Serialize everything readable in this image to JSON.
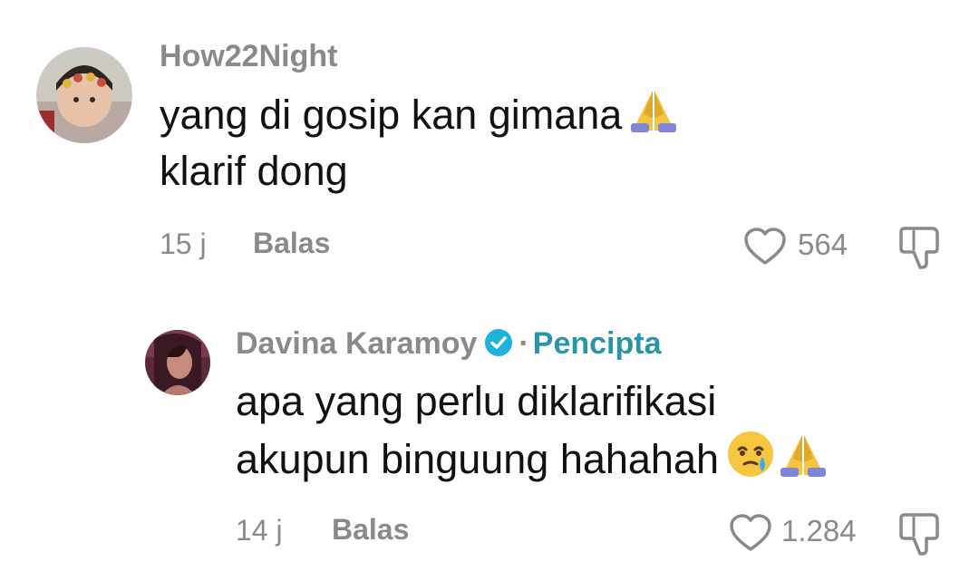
{
  "comments": [
    {
      "username": "How22Night",
      "text_line1": "yang di gosip kan gimana",
      "text_line2": "klarif dong",
      "emojis_line1": [
        "folded-hands"
      ],
      "time": "15 j",
      "reply_label": "Balas",
      "likes": "564"
    },
    {
      "username": "Davina Karamoy",
      "verified": true,
      "separator": "·",
      "creator_label": "Pencipta",
      "text_line1": "apa yang perlu diklarifikasi",
      "text_line2": "akupun binguung hahahah",
      "emojis_line2": [
        "face-holding-back-tears",
        "folded-hands"
      ],
      "time": "14 j",
      "reply_label": "Balas",
      "likes": "1.284"
    }
  ],
  "colors": {
    "secondary_text": "#8a8a8a",
    "primary_text": "#111111",
    "creator_accent": "#2a95a8",
    "verified_badge": "#20b2d8"
  }
}
